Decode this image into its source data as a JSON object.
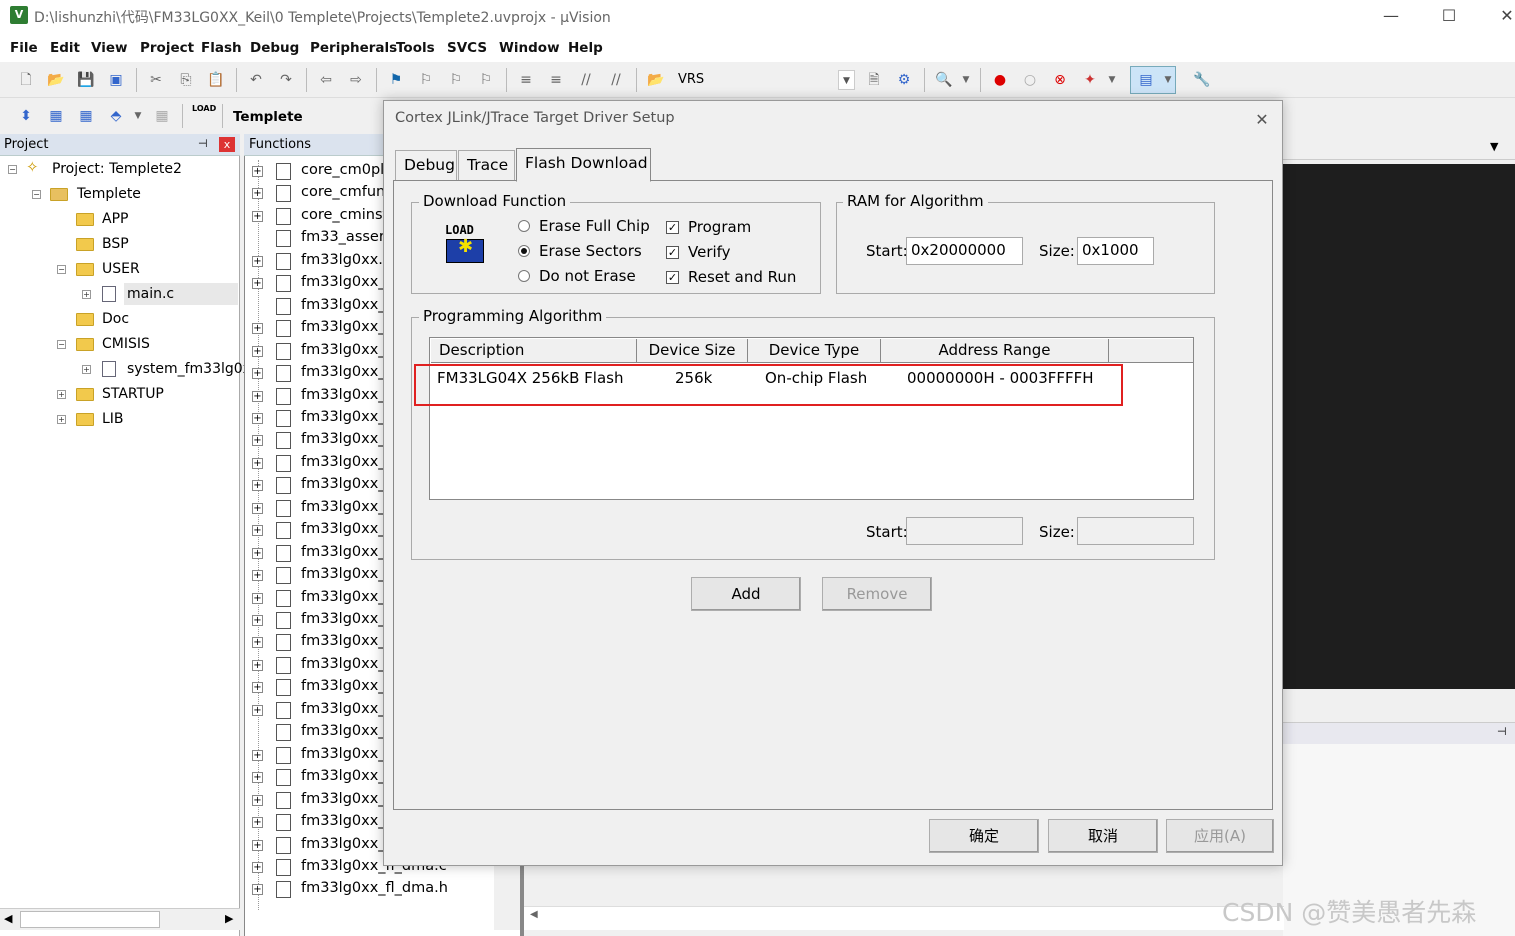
{
  "window": {
    "title": "D:\\lishunzhi\\代码\\FM33LG0XX_Keil\\0 Templete\\Projects\\Templete2.uvprojx - µVision",
    "app_icon": "V",
    "controls": {
      "minimize": "—",
      "maximize": "☐",
      "close": "✕"
    }
  },
  "menu": [
    "File",
    "Edit",
    "View",
    "Project",
    "Flash",
    "Debug",
    "Peripherals",
    "Tools",
    "SVCS",
    "Window",
    "Help"
  ],
  "toolbar": {
    "combo_label": "VRS",
    "target": "Templete",
    "load_icon_text": "LOAD"
  },
  "project_panel": {
    "title": "Project",
    "pin": "⊣",
    "close": "x",
    "tree": [
      {
        "label": "Project: Templete2",
        "icon": "project-icon"
      },
      {
        "label": "Templete",
        "icon": "target-icon"
      },
      {
        "label": "APP",
        "icon": "folder-icon"
      },
      {
        "label": "BSP",
        "icon": "folder-icon"
      },
      {
        "label": "USER",
        "icon": "folder-icon"
      },
      {
        "label": "main.c",
        "icon": "file-icon"
      },
      {
        "label": "Doc",
        "icon": "folder-icon"
      },
      {
        "label": "CMISIS",
        "icon": "folder-icon"
      },
      {
        "label": "system_fm33lg0x",
        "icon": "file-icon"
      },
      {
        "label": "STARTUP",
        "icon": "folder-icon"
      },
      {
        "label": "LIB",
        "icon": "folder-icon"
      }
    ]
  },
  "functions_panel": {
    "title": "Functions",
    "items": [
      "core_cm0pl",
      "core_cmfun",
      "core_cminst",
      "fm33_assert",
      "fm33lg0xx.h",
      "fm33lg0xx_",
      "fm33lg0xx_",
      "fm33lg0xx_",
      "fm33lg0xx_",
      "fm33lg0xx_",
      "fm33lg0xx_",
      "fm33lg0xx_",
      "fm33lg0xx_",
      "fm33lg0xx_",
      "fm33lg0xx_",
      "fm33lg0xx_",
      "fm33lg0xx_",
      "fm33lg0xx_",
      "fm33lg0xx_",
      "fm33lg0xx_",
      "fm33lg0xx_",
      "fm33lg0xx_",
      "fm33lg0xx_",
      "fm33lg0xx_",
      "fm33lg0xx_",
      "fm33lg0xx_",
      "fm33lg0xx_",
      "fm33lg0xx_",
      "fm33lg0xx_",
      "fm33lg0xx_",
      "fm33lg0xx_fl_divas.h",
      "fm33lg0xx_fl_dma.c",
      "fm33lg0xx_fl_dma.h"
    ]
  },
  "dialog": {
    "title": "Cortex JLink/JTrace Target Driver Setup",
    "close": "✕",
    "tabs": [
      "Debug",
      "Trace",
      "Flash Download"
    ],
    "active_tab": "Flash Download",
    "download_function": {
      "label": "Download Function",
      "icon_text": "LOAD",
      "radios": [
        {
          "label": "Erase Full Chip",
          "checked": false
        },
        {
          "label": "Erase Sectors",
          "checked": true
        },
        {
          "label": "Do not Erase",
          "checked": false
        }
      ],
      "checks": [
        {
          "label": "Program",
          "checked": true
        },
        {
          "label": "Verify",
          "checked": true
        },
        {
          "label": "Reset and Run",
          "checked": true
        }
      ]
    },
    "ram": {
      "label": "RAM for Algorithm",
      "start_label": "Start:",
      "start_value": "0x20000000",
      "size_label": "Size:",
      "size_value": "0x1000"
    },
    "algorithm": {
      "label": "Programming Algorithm",
      "columns": [
        "Description",
        "Device Size",
        "Device Type",
        "Address Range"
      ],
      "rows": [
        {
          "description": "FM33LG04X 256kB Flash",
          "size": "256k",
          "type": "On-chip Flash",
          "range": "00000000H - 0003FFFFH"
        }
      ],
      "start_label": "Start:",
      "start_value": "",
      "size_label": "Size:",
      "size_value": ""
    },
    "buttons": {
      "add": "Add",
      "remove": "Remove",
      "ok": "确定",
      "cancel": "取消",
      "apply": "应用(A)"
    }
  },
  "watermark": "CSDN @赞美愚者先森",
  "colors": {
    "highlight": "#e02020",
    "editor_bg": "#1e1e1e",
    "panel_header": "#dbe3ee"
  }
}
